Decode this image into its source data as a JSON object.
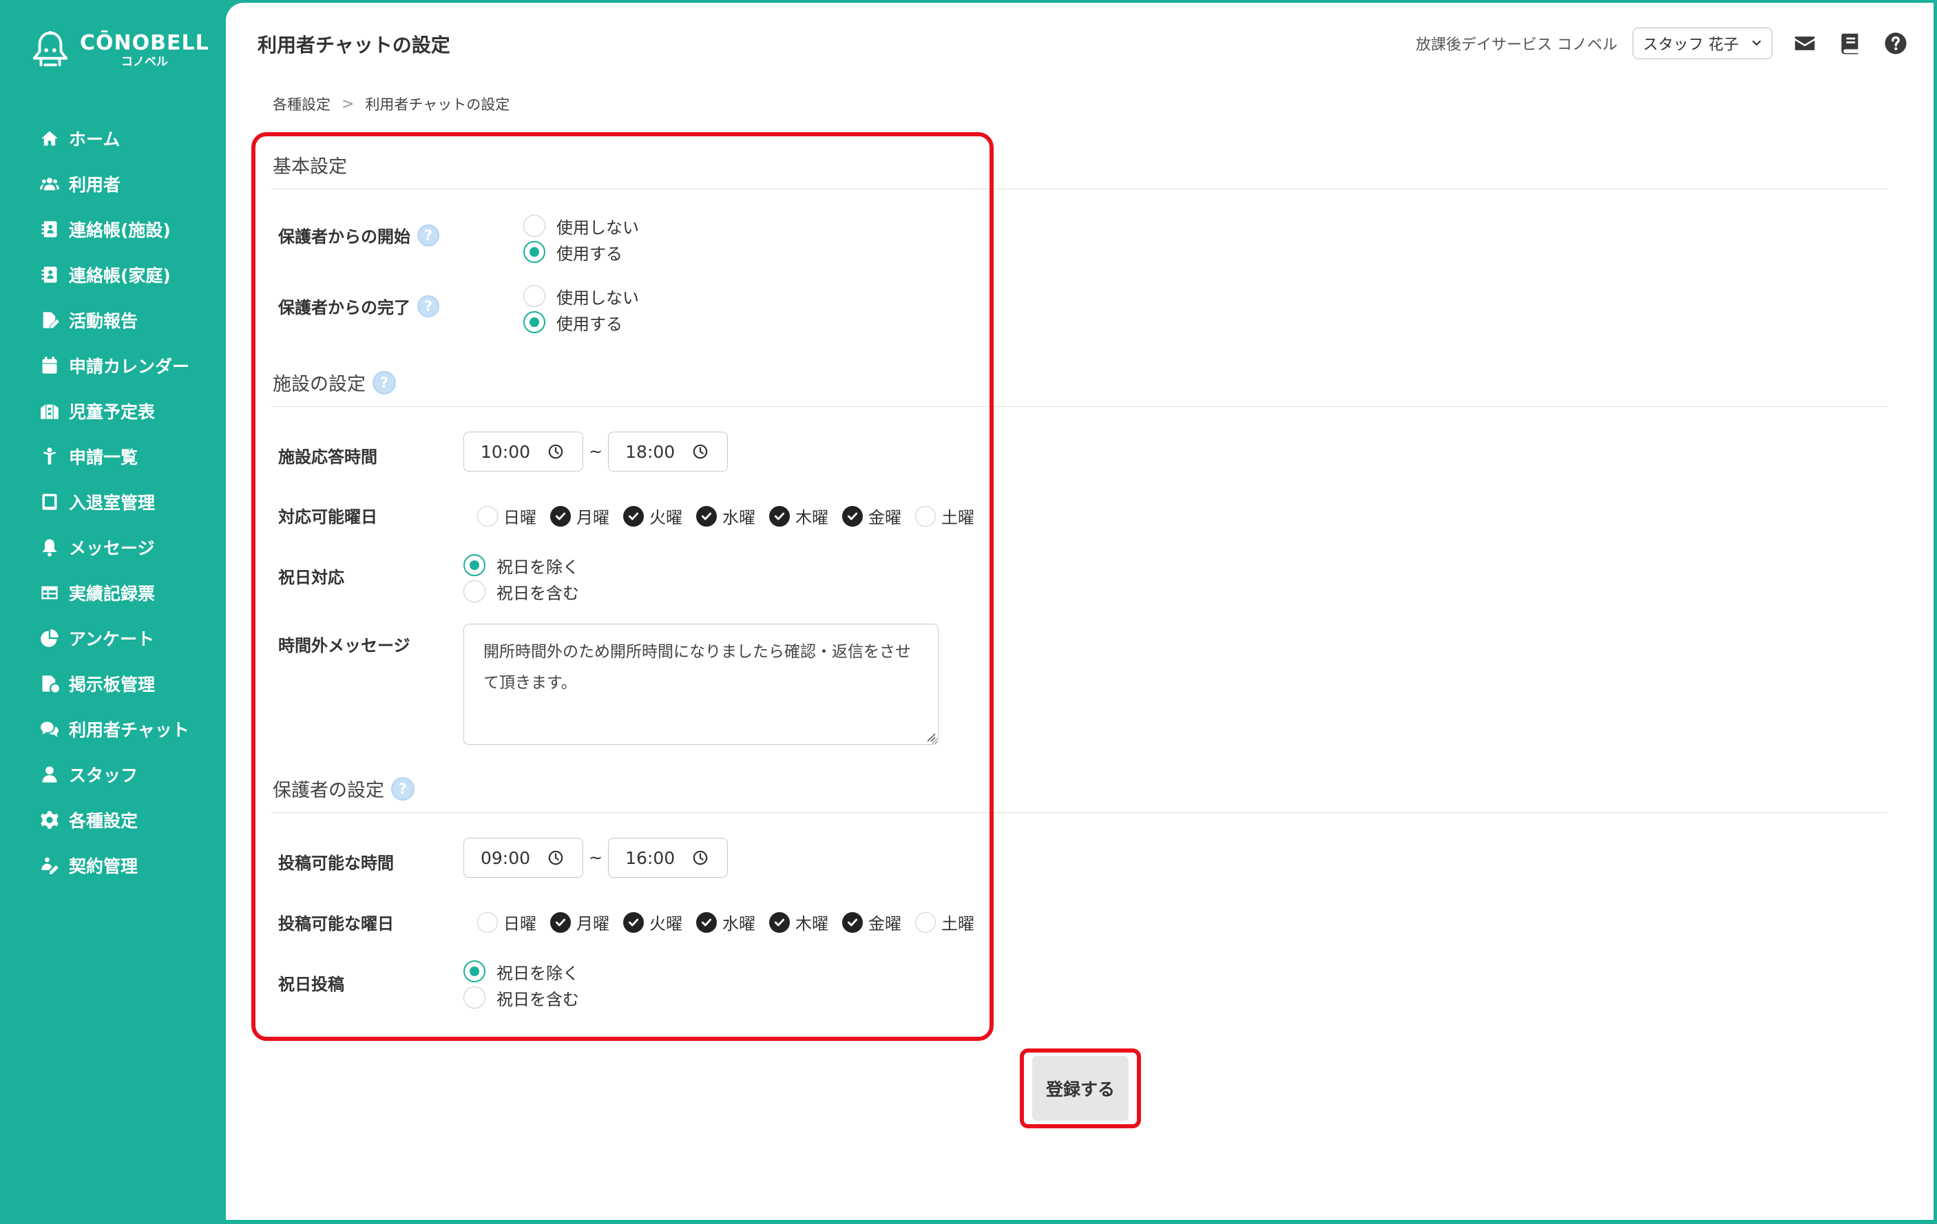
{
  "app": {
    "brand": "CŌNOBELL",
    "brand_sub": "コノベル"
  },
  "sidebar": {
    "items": [
      {
        "label": "ホーム",
        "icon": "home-icon"
      },
      {
        "label": "利用者",
        "icon": "users-icon"
      },
      {
        "label": "連絡帳(施設)",
        "icon": "contact-book-icon"
      },
      {
        "label": "連絡帳(家庭)",
        "icon": "contact-book-icon"
      },
      {
        "label": "活動報告",
        "icon": "report-icon"
      },
      {
        "label": "申請カレンダー",
        "icon": "calendar-icon"
      },
      {
        "label": "児童予定表",
        "icon": "schedule-icon"
      },
      {
        "label": "申請一覧",
        "icon": "person-icon"
      },
      {
        "label": "入退室管理",
        "icon": "tablet-icon"
      },
      {
        "label": "メッセージ",
        "icon": "bell-icon"
      },
      {
        "label": "実績記録票",
        "icon": "table-icon"
      },
      {
        "label": "アンケート",
        "icon": "pie-chart-icon"
      },
      {
        "label": "掲示板管理",
        "icon": "board-icon"
      },
      {
        "label": "利用者チャット",
        "icon": "chat-icon"
      },
      {
        "label": "スタッフ",
        "icon": "staff-icon"
      },
      {
        "label": "各種設定",
        "icon": "gear-icon"
      },
      {
        "label": "契約管理",
        "icon": "contract-icon"
      }
    ]
  },
  "header": {
    "title": "利用者チャットの設定",
    "facility": "放課後デイサービス コノベル",
    "staff_selected": "スタッフ 花子"
  },
  "breadcrumb": {
    "parent": "各種設定",
    "separator": ">",
    "current": "利用者チャットの設定"
  },
  "basic": {
    "title": "基本設定",
    "guardian_start": {
      "label": "保護者からの開始",
      "options": [
        "使用しない",
        "使用する"
      ],
      "selected": "使用する"
    },
    "guardian_end": {
      "label": "保護者からの完了",
      "options": [
        "使用しない",
        "使用する"
      ],
      "selected": "使用する"
    }
  },
  "facility": {
    "title": "施設の設定",
    "response_time": {
      "label": "施設応答時間",
      "start": "10:00",
      "end": "18:00",
      "tilde": "~"
    },
    "available_days": {
      "label": "対応可能曜日",
      "days": [
        {
          "label": "日曜",
          "checked": false
        },
        {
          "label": "月曜",
          "checked": true
        },
        {
          "label": "火曜",
          "checked": true
        },
        {
          "label": "水曜",
          "checked": true
        },
        {
          "label": "木曜",
          "checked": true
        },
        {
          "label": "金曜",
          "checked": true
        },
        {
          "label": "土曜",
          "checked": false
        }
      ]
    },
    "holiday": {
      "label": "祝日対応",
      "options": [
        "祝日を除く",
        "祝日を含む"
      ],
      "selected": "祝日を除く"
    },
    "offhours_message": {
      "label": "時間外メッセージ",
      "value": "開所時間外のため開所時間になりましたら確認・返信をさせて頂きます。"
    }
  },
  "guardian": {
    "title": "保護者の設定",
    "post_time": {
      "label": "投稿可能な時間",
      "start": "09:00",
      "end": "16:00",
      "tilde": "~"
    },
    "post_days": {
      "label": "投稿可能な曜日",
      "days": [
        {
          "label": "日曜",
          "checked": false
        },
        {
          "label": "月曜",
          "checked": true
        },
        {
          "label": "火曜",
          "checked": true
        },
        {
          "label": "水曜",
          "checked": true
        },
        {
          "label": "木曜",
          "checked": true
        },
        {
          "label": "金曜",
          "checked": true
        },
        {
          "label": "土曜",
          "checked": false
        }
      ]
    },
    "holiday_post": {
      "label": "祝日投稿",
      "options": [
        "祝日を除く",
        "祝日を含む"
      ],
      "selected": "祝日を除く"
    }
  },
  "actions": {
    "submit_label": "登録する"
  },
  "colors": {
    "brand": "#1ab09a",
    "highlight": "#e8101b",
    "help_badge": "#c6e0f6"
  }
}
